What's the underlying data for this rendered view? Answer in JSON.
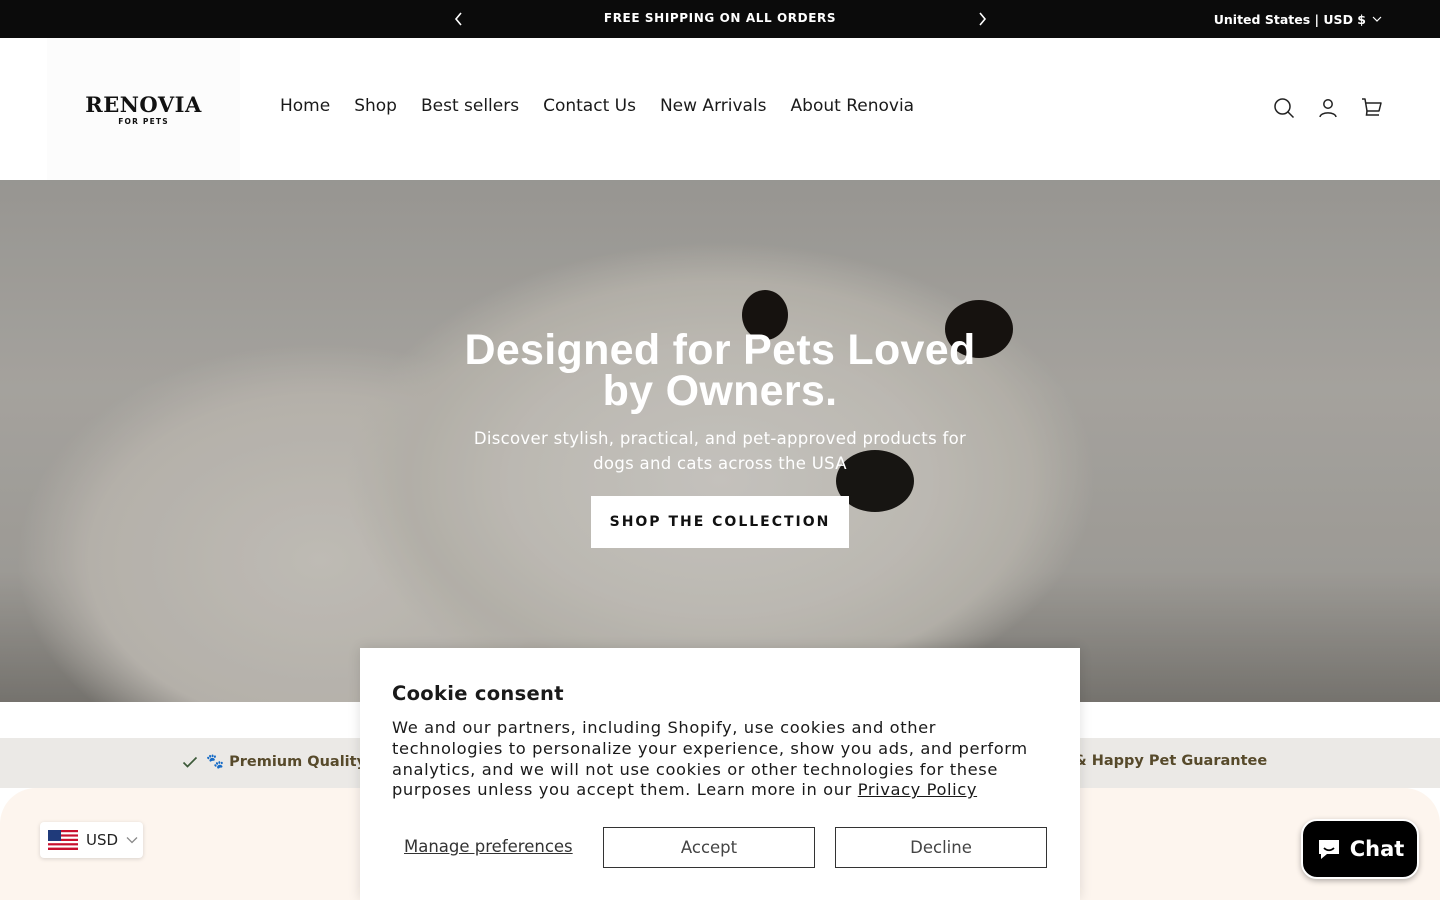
{
  "announcement": {
    "message": "FREE SHIPPING ON ALL ORDERS",
    "locale": "United States | USD $"
  },
  "header": {
    "logo_brand": "RENOVIA",
    "logo_sub": "FOR PETS",
    "nav": [
      "Home",
      "Shop",
      "Best sellers",
      "Contact Us",
      "New Arrivals",
      "About Renovia"
    ],
    "icons": [
      "search-icon",
      "account-icon",
      "cart-icon"
    ]
  },
  "hero": {
    "title": "Designed for Pets Loved by Owners.",
    "subtitle": "Discover stylish, practical, and pet-approved products for dogs and cats across the USA",
    "button": "SHOP THE COLLECTION"
  },
  "features": [
    "🐾 Premium Quality",
    "& Happy Pet Guarantee"
  ],
  "currency": {
    "code": "USD"
  },
  "chat": {
    "label": "Chat"
  },
  "cookie": {
    "title": "Cookie consent",
    "body": "We and our partners, including Shopify, use cookies and other technologies to personalize your experience, show you ads, and perform analytics, and we will not use cookies or other technologies for these purposes unless you accept them. Learn more in our",
    "privacy_link": "Privacy Policy",
    "manage": "Manage preferences",
    "accept": "Accept",
    "decline": "Decline"
  },
  "colors": {
    "announce_bg": "#0b0b0b",
    "feature_text": "#574a2b",
    "features_bg": "#ebe9e6",
    "lower_bg": "#fdf5ee"
  }
}
